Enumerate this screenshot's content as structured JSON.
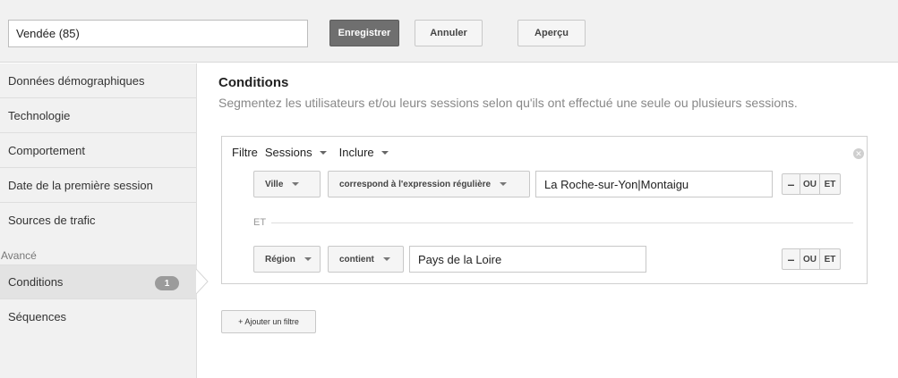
{
  "header": {
    "segment_name": "Vendée (85)",
    "save_label": "Enregistrer",
    "cancel_label": "Annuler",
    "preview_label": "Aperçu"
  },
  "sidebar": {
    "items": [
      {
        "label": "Données démographiques"
      },
      {
        "label": "Technologie"
      },
      {
        "label": "Comportement"
      },
      {
        "label": "Date de la première session"
      },
      {
        "label": "Sources de trafic"
      }
    ],
    "advanced_label": "Avancé",
    "advanced_items": [
      {
        "label": "Conditions",
        "badge": "1",
        "active": true
      },
      {
        "label": "Séquences"
      }
    ]
  },
  "main": {
    "title": "Conditions",
    "description": "Segmentez les utilisateurs et/ou leurs sessions selon qu'ils ont effectué une seule ou plusieurs sessions.",
    "filter": {
      "label": "Filtre",
      "scope": "Sessions",
      "mode": "Inclure",
      "remove_icon": "x-circle-icon",
      "conditions": [
        {
          "dimension": "Ville",
          "operator": "correspond à l'expression régulière",
          "value": "La Roche-sur-Yon|Montaigu"
        },
        {
          "dimension": "Région",
          "operator": "contient",
          "value": "Pays de la Loire"
        }
      ],
      "separator": "ET",
      "minus_label": "–",
      "or_label": "OU",
      "and_label": "ET"
    },
    "add_filter_label": "+ Ajouter un filtre"
  },
  "colors": {
    "save_button": "#6f6f6f",
    "sidebar_bg": "#f1f1f1",
    "badge": "#9b9b9b"
  }
}
